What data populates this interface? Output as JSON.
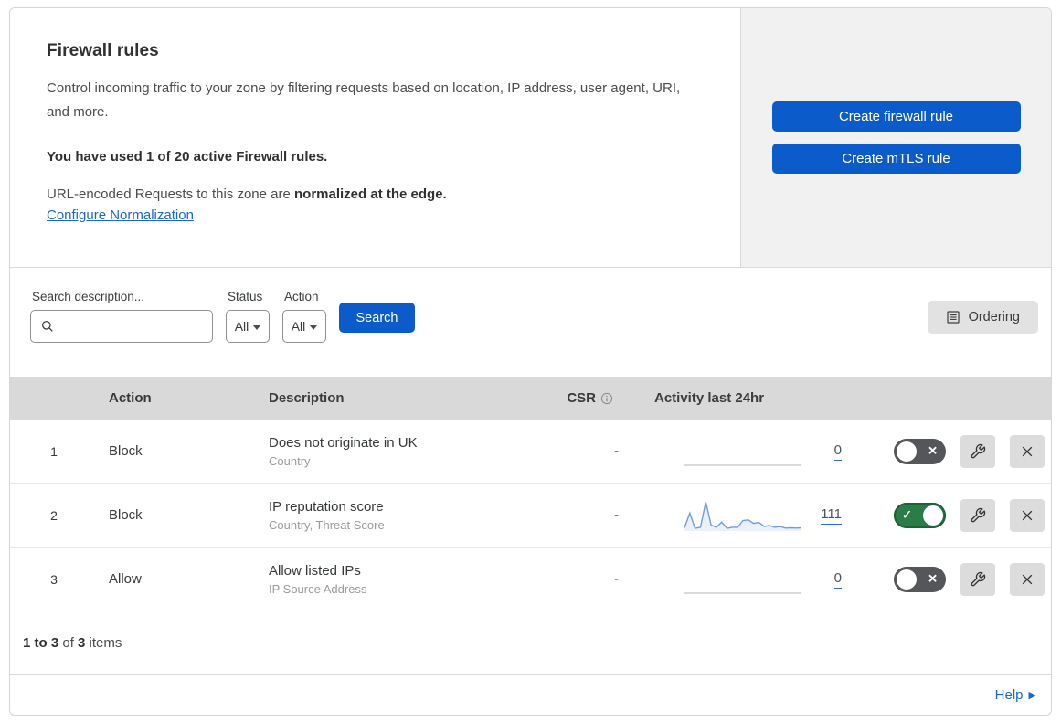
{
  "header": {
    "title": "Firewall rules",
    "description": "Control incoming traffic to your zone by filtering requests based on location, IP address, user agent, URI, and more.",
    "usage": "You have used 1 of 20 active Firewall rules.",
    "normalization_text": "URL-encoded Requests to this zone are ",
    "normalization_bold": "normalized at the edge.",
    "normalization_link": "Configure Normalization",
    "create_firewall_label": "Create firewall rule",
    "create_mtls_label": "Create mTLS rule"
  },
  "filters": {
    "search_label": "Search description...",
    "search_placeholder": "",
    "search_value": "",
    "status_label": "Status",
    "status_value": "All",
    "action_label": "Action",
    "action_value": "All",
    "search_button_label": "Search",
    "ordering_button_label": "Ordering"
  },
  "table": {
    "headers": {
      "action": "Action",
      "description": "Description",
      "csr": "CSR",
      "activity": "Activity last 24hr"
    },
    "rows": [
      {
        "num": "1",
        "action": "Block",
        "description": "Does not originate in UK",
        "criteria": "Country",
        "csr": "-",
        "count": "0",
        "enabled": false,
        "has_sparkline": false
      },
      {
        "num": "2",
        "action": "Block",
        "description": "IP reputation score",
        "criteria": "Country, Threat Score",
        "csr": "-",
        "count": "111",
        "enabled": true,
        "has_sparkline": true
      },
      {
        "num": "3",
        "action": "Allow",
        "description": "Allow listed IPs",
        "criteria": "IP Source Address",
        "csr": "-",
        "count": "0",
        "enabled": false,
        "has_sparkline": false
      }
    ],
    "toggle_on_mark": "✓",
    "toggle_off_mark": "✕"
  },
  "chart_data": {
    "type": "area",
    "title": "Activity last 24hr sparkline (rule 2)",
    "x": [
      0,
      1,
      2,
      3,
      4,
      5,
      6,
      7,
      8,
      9,
      10,
      11,
      12,
      13,
      14,
      15,
      16,
      17,
      18,
      19,
      20,
      21,
      22
    ],
    "values": [
      8,
      60,
      6,
      10,
      100,
      18,
      10,
      28,
      6,
      10,
      10,
      34,
      36,
      24,
      27,
      13,
      16,
      10,
      13,
      7,
      8,
      7,
      8
    ],
    "ylim": [
      0,
      100
    ],
    "total_label": "111",
    "grid": false,
    "legend": false
  },
  "footer": {
    "range": "1 to 3",
    "of_word": " of ",
    "total": "3",
    "items_word": " items",
    "help_label": "Help"
  },
  "colors": {
    "primary_blue": "#0b5cca",
    "link_blue": "#1767d2",
    "toggle_on_green": "#2a7d46",
    "toggle_off_gray": "#54565a",
    "table_header_gray": "#d9d9d9",
    "side_panel_gray": "#f1f1f1",
    "sparkline_blue": "#6f9de3"
  }
}
